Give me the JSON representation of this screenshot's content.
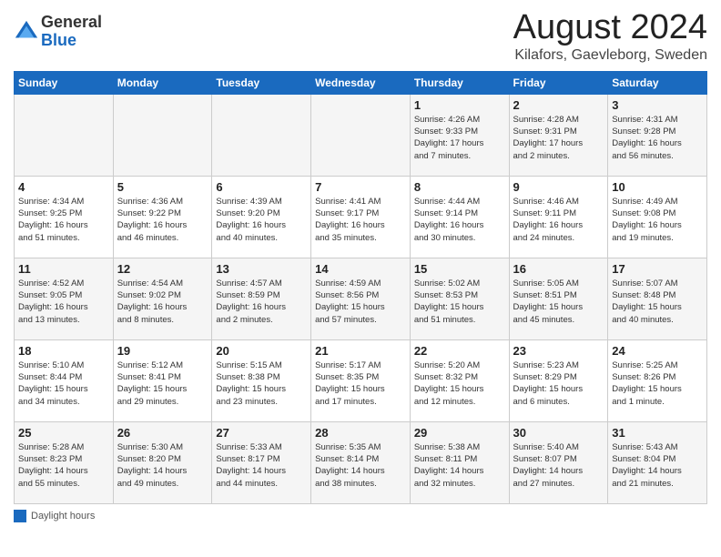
{
  "header": {
    "logo_general": "General",
    "logo_blue": "Blue",
    "month_title": "August 2024",
    "subtitle": "Kilafors, Gaevleborg, Sweden"
  },
  "days_of_week": [
    "Sunday",
    "Monday",
    "Tuesday",
    "Wednesday",
    "Thursday",
    "Friday",
    "Saturday"
  ],
  "weeks": [
    [
      {
        "num": "",
        "info": ""
      },
      {
        "num": "",
        "info": ""
      },
      {
        "num": "",
        "info": ""
      },
      {
        "num": "",
        "info": ""
      },
      {
        "num": "1",
        "info": "Sunrise: 4:26 AM\nSunset: 9:33 PM\nDaylight: 17 hours\nand 7 minutes."
      },
      {
        "num": "2",
        "info": "Sunrise: 4:28 AM\nSunset: 9:31 PM\nDaylight: 17 hours\nand 2 minutes."
      },
      {
        "num": "3",
        "info": "Sunrise: 4:31 AM\nSunset: 9:28 PM\nDaylight: 16 hours\nand 56 minutes."
      }
    ],
    [
      {
        "num": "4",
        "info": "Sunrise: 4:34 AM\nSunset: 9:25 PM\nDaylight: 16 hours\nand 51 minutes."
      },
      {
        "num": "5",
        "info": "Sunrise: 4:36 AM\nSunset: 9:22 PM\nDaylight: 16 hours\nand 46 minutes."
      },
      {
        "num": "6",
        "info": "Sunrise: 4:39 AM\nSunset: 9:20 PM\nDaylight: 16 hours\nand 40 minutes."
      },
      {
        "num": "7",
        "info": "Sunrise: 4:41 AM\nSunset: 9:17 PM\nDaylight: 16 hours\nand 35 minutes."
      },
      {
        "num": "8",
        "info": "Sunrise: 4:44 AM\nSunset: 9:14 PM\nDaylight: 16 hours\nand 30 minutes."
      },
      {
        "num": "9",
        "info": "Sunrise: 4:46 AM\nSunset: 9:11 PM\nDaylight: 16 hours\nand 24 minutes."
      },
      {
        "num": "10",
        "info": "Sunrise: 4:49 AM\nSunset: 9:08 PM\nDaylight: 16 hours\nand 19 minutes."
      }
    ],
    [
      {
        "num": "11",
        "info": "Sunrise: 4:52 AM\nSunset: 9:05 PM\nDaylight: 16 hours\nand 13 minutes."
      },
      {
        "num": "12",
        "info": "Sunrise: 4:54 AM\nSunset: 9:02 PM\nDaylight: 16 hours\nand 8 minutes."
      },
      {
        "num": "13",
        "info": "Sunrise: 4:57 AM\nSunset: 8:59 PM\nDaylight: 16 hours\nand 2 minutes."
      },
      {
        "num": "14",
        "info": "Sunrise: 4:59 AM\nSunset: 8:56 PM\nDaylight: 15 hours\nand 57 minutes."
      },
      {
        "num": "15",
        "info": "Sunrise: 5:02 AM\nSunset: 8:53 PM\nDaylight: 15 hours\nand 51 minutes."
      },
      {
        "num": "16",
        "info": "Sunrise: 5:05 AM\nSunset: 8:51 PM\nDaylight: 15 hours\nand 45 minutes."
      },
      {
        "num": "17",
        "info": "Sunrise: 5:07 AM\nSunset: 8:48 PM\nDaylight: 15 hours\nand 40 minutes."
      }
    ],
    [
      {
        "num": "18",
        "info": "Sunrise: 5:10 AM\nSunset: 8:44 PM\nDaylight: 15 hours\nand 34 minutes."
      },
      {
        "num": "19",
        "info": "Sunrise: 5:12 AM\nSunset: 8:41 PM\nDaylight: 15 hours\nand 29 minutes."
      },
      {
        "num": "20",
        "info": "Sunrise: 5:15 AM\nSunset: 8:38 PM\nDaylight: 15 hours\nand 23 minutes."
      },
      {
        "num": "21",
        "info": "Sunrise: 5:17 AM\nSunset: 8:35 PM\nDaylight: 15 hours\nand 17 minutes."
      },
      {
        "num": "22",
        "info": "Sunrise: 5:20 AM\nSunset: 8:32 PM\nDaylight: 15 hours\nand 12 minutes."
      },
      {
        "num": "23",
        "info": "Sunrise: 5:23 AM\nSunset: 8:29 PM\nDaylight: 15 hours\nand 6 minutes."
      },
      {
        "num": "24",
        "info": "Sunrise: 5:25 AM\nSunset: 8:26 PM\nDaylight: 15 hours\nand 1 minute."
      }
    ],
    [
      {
        "num": "25",
        "info": "Sunrise: 5:28 AM\nSunset: 8:23 PM\nDaylight: 14 hours\nand 55 minutes."
      },
      {
        "num": "26",
        "info": "Sunrise: 5:30 AM\nSunset: 8:20 PM\nDaylight: 14 hours\nand 49 minutes."
      },
      {
        "num": "27",
        "info": "Sunrise: 5:33 AM\nSunset: 8:17 PM\nDaylight: 14 hours\nand 44 minutes."
      },
      {
        "num": "28",
        "info": "Sunrise: 5:35 AM\nSunset: 8:14 PM\nDaylight: 14 hours\nand 38 minutes."
      },
      {
        "num": "29",
        "info": "Sunrise: 5:38 AM\nSunset: 8:11 PM\nDaylight: 14 hours\nand 32 minutes."
      },
      {
        "num": "30",
        "info": "Sunrise: 5:40 AM\nSunset: 8:07 PM\nDaylight: 14 hours\nand 27 minutes."
      },
      {
        "num": "31",
        "info": "Sunrise: 5:43 AM\nSunset: 8:04 PM\nDaylight: 14 hours\nand 21 minutes."
      }
    ]
  ],
  "footer": {
    "legend_label": "Daylight hours"
  }
}
